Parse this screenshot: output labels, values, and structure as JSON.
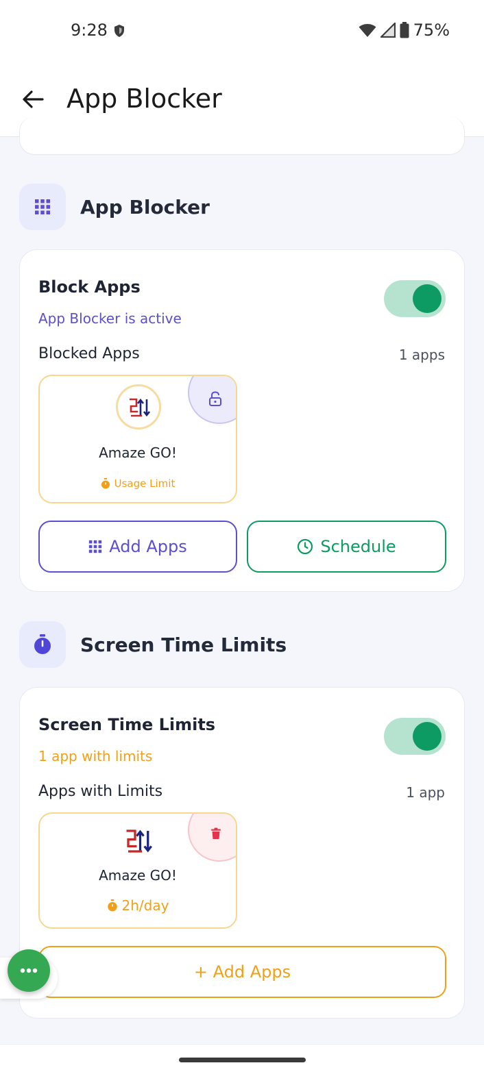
{
  "status_bar": {
    "time": "9:28",
    "battery": "75%"
  },
  "app_bar": {
    "title": "App Blocker"
  },
  "blocker_section": {
    "title": "App Blocker",
    "icon": "grid-icon"
  },
  "block_card": {
    "title": "Block Apps",
    "status": "App Blocker is active",
    "toggle_on": true,
    "list_label": "Blocked Apps",
    "count": "1 apps",
    "app": {
      "name": "Amaze GO!",
      "meta": "Usage Limit"
    },
    "add_label": "Add Apps",
    "schedule_label": "Schedule"
  },
  "limits_section": {
    "title": "Screen Time Limits",
    "icon": "stopwatch-icon"
  },
  "limits_card": {
    "title": "Screen Time Limits",
    "status": "1 app with limits",
    "toggle_on": true,
    "list_label": "Apps with Limits",
    "count": "1 app",
    "app": {
      "name": "Amaze GO!",
      "limit": "2h/day"
    },
    "add_label": "+ Add Apps"
  },
  "colors": {
    "accent_purple": "#5b4fcf",
    "accent_green": "#0d9b63",
    "accent_orange": "#f0a018",
    "danger_red": "#e2344c"
  }
}
